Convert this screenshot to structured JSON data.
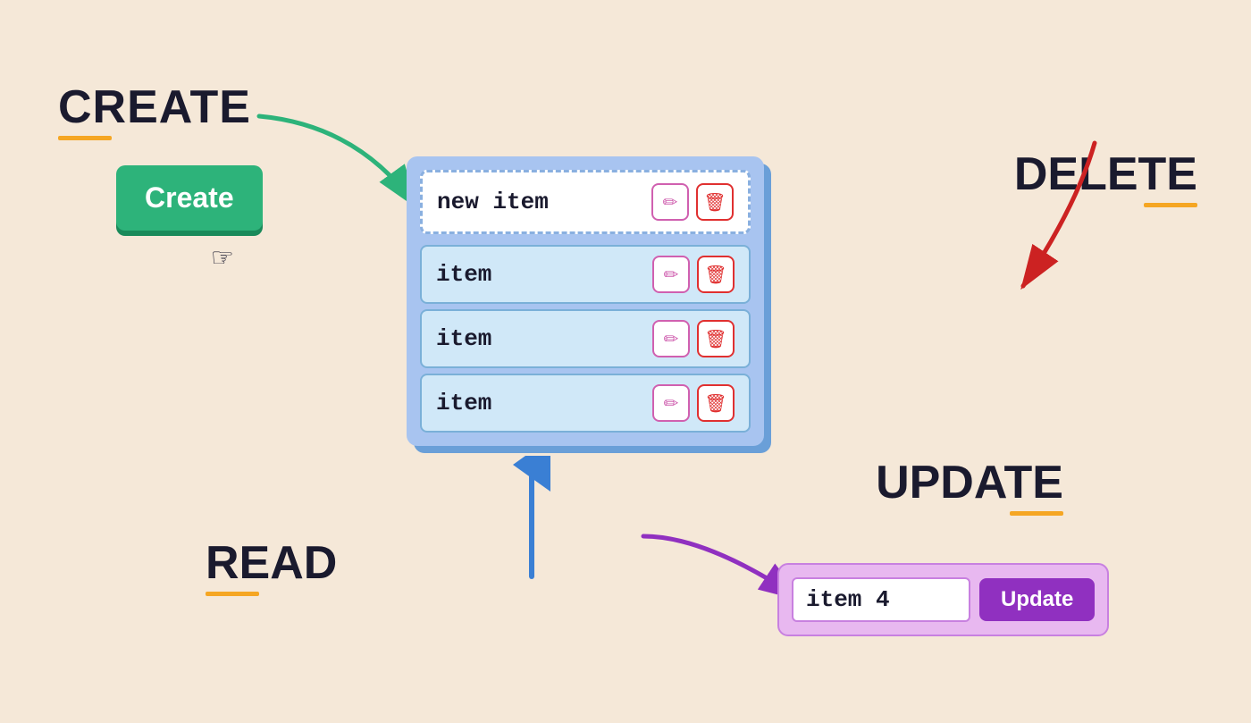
{
  "background_color": "#f5e8d8",
  "labels": {
    "create": "CREATE",
    "delete": "DELETE",
    "read": "READ",
    "update": "UPDATE"
  },
  "create_button": {
    "label": "Create"
  },
  "list": {
    "new_item": "new item",
    "items": [
      "item",
      "item",
      "item"
    ]
  },
  "update_form": {
    "input_value": "item 4",
    "button_label": "Update"
  },
  "icons": {
    "edit": "✏️",
    "delete": "🗑",
    "cursor": "☞"
  }
}
